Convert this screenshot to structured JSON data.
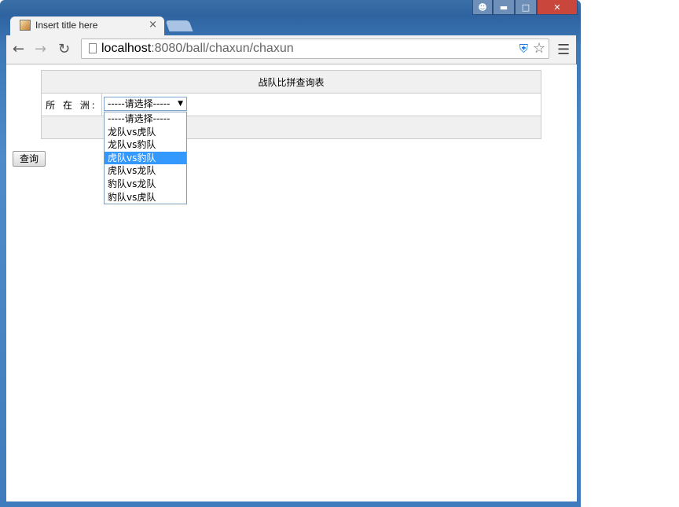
{
  "browser": {
    "tab_title": "Insert title here",
    "tab_close": "×",
    "url_host": "localhost",
    "url_rest": ":8080/ball/chaxun/chaxun",
    "window_controls": [
      "user-icon",
      "minimize-icon",
      "maximize-icon",
      "close-icon"
    ]
  },
  "page": {
    "table_title": "战队比拼查询表",
    "field_label": "所 在 洲:",
    "select_value": "-----请选择-----",
    "options": [
      "-----请选择-----",
      "龙队vs虎队",
      "龙队vs豹队",
      "虎队vs豹队",
      "虎队vs龙队",
      "豹队vs龙队",
      "豹队vs虎队"
    ],
    "highlighted_option": "虎队vs豹队",
    "query_button": "查询"
  },
  "colors": {
    "selection": "#3399ff",
    "table_header_bg": "#f0f0f0",
    "border": "#cccccc"
  }
}
